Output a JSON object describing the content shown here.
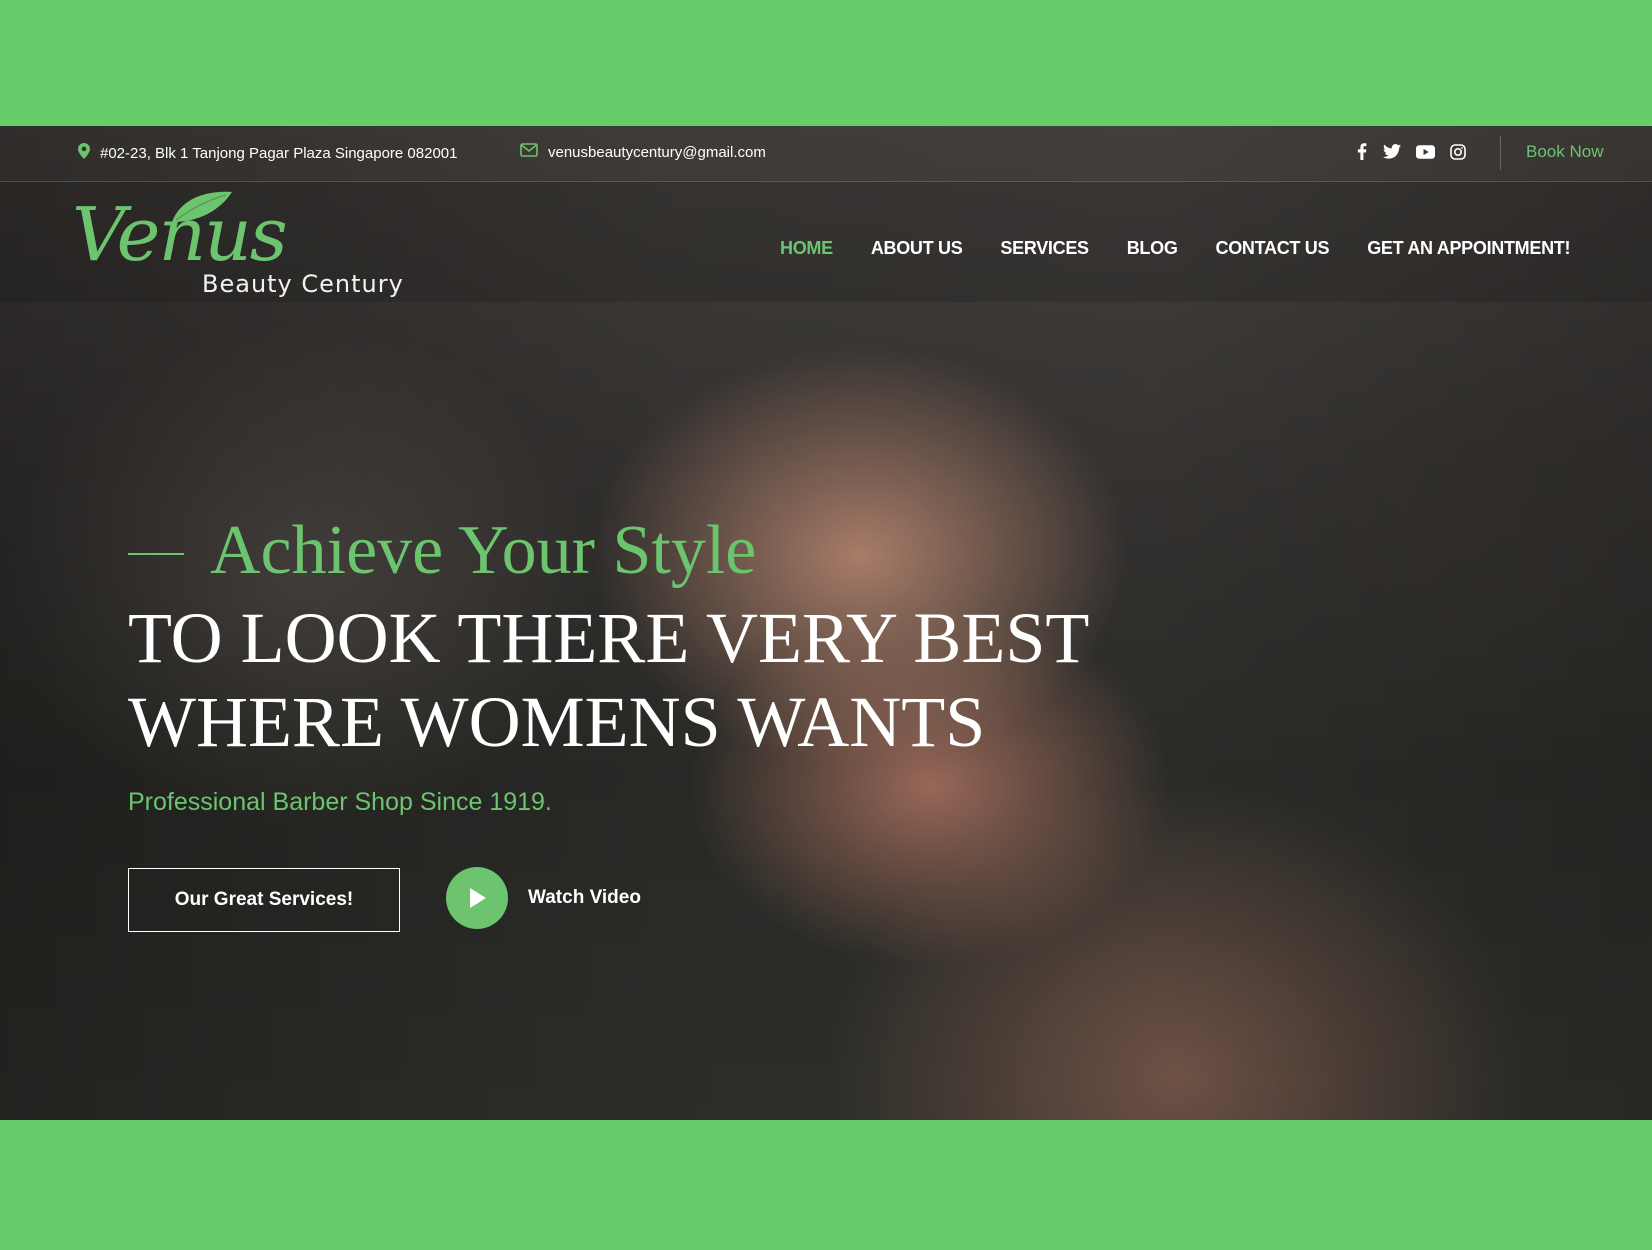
{
  "topbar": {
    "address": "#02-23, Blk 1 Tanjong Pagar Plaza Singapore 082001",
    "email": "venusbeautycentury@gmail.com",
    "social": [
      "facebook-icon",
      "twitter-icon",
      "youtube-icon",
      "instagram-icon"
    ],
    "book_now": "Book Now"
  },
  "logo": {
    "word": "Venus",
    "sub": "Beauty Century"
  },
  "nav": {
    "items": [
      {
        "label": "HOME",
        "active": true
      },
      {
        "label": "ABOUT US"
      },
      {
        "label": "SERVICES"
      },
      {
        "label": "BLOG"
      },
      {
        "label": "CONTACT US"
      },
      {
        "label": "GET AN APPOINTMENT!"
      }
    ]
  },
  "hero": {
    "script": "Achieve Your Style",
    "line1": "TO LOOK THERE VERY BEST",
    "line2": "WHERE WOMENS WANTS",
    "subtitle": "Professional Barber Shop Since 1919.",
    "services_button": "Our Great Services!",
    "watch_video": "Watch Video"
  },
  "colors": {
    "accent": "#6cc46f",
    "outer": "#67cd6a"
  }
}
